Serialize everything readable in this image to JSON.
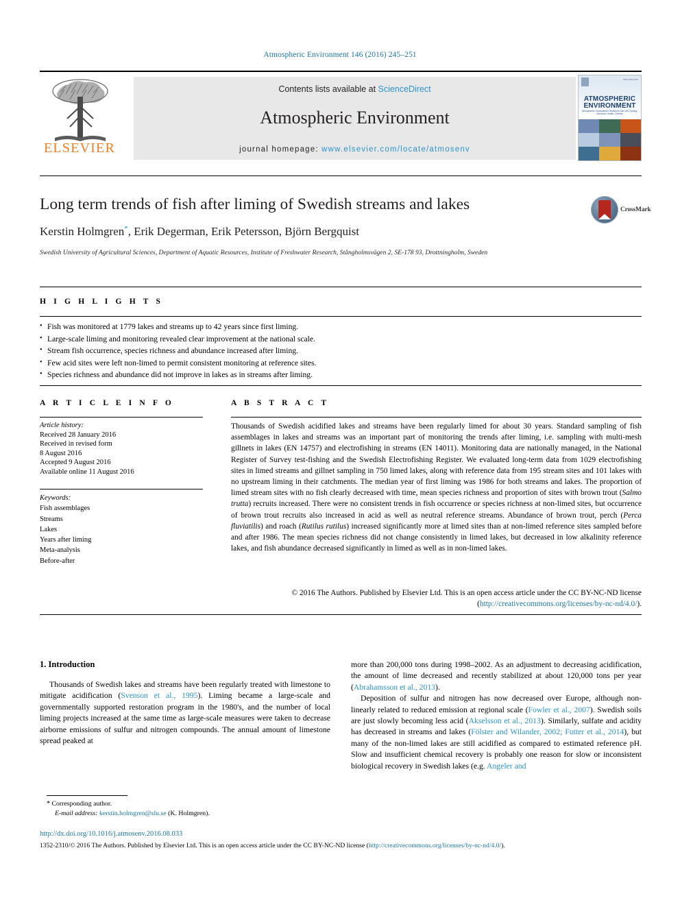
{
  "running_head": "Atmospheric Environment 146 (2016) 245–251",
  "masthead": {
    "publisher_wordmark": "ELSEVIER",
    "contents_prefix": "Contents lists available at ",
    "contents_link": "ScienceDirect",
    "journal_name": "Atmospheric Environment",
    "homepage_label": "journal homepage: ",
    "homepage_url": "www.elsevier.com/locate/atmosenv",
    "cover": {
      "title_line1": "ATMOSPHERIC",
      "title_line2": "ENVIRONMENT",
      "subtitle": "Atmospheric Composition Reactions Gas Life Cycling, Aerosols, Health, Climate",
      "issn_corner": "ISSN 1352-2310"
    }
  },
  "article": {
    "title": "Long term trends of fish after liming of Swedish streams and lakes",
    "authors": "Kerstin Holmgren, Erik Degerman, Erik Petersson, Björn Bergquist",
    "corresponding_marker": "*",
    "affiliation": "Swedish University of Agricultural Sciences, Department of Aquatic Resources, Institute of Freshwater Research, Stångholmsvägen 2, SE-178 93, Drottningholm, Sweden",
    "crossmark_label": "CrossMark"
  },
  "highlights": {
    "heading": "H I G H L I G H T S",
    "items": [
      "Fish was monitored at 1779 lakes and streams up to 42 years since first liming.",
      "Large-scale liming and monitoring revealed clear improvement at the national scale.",
      "Stream fish occurrence, species richness and abundance increased after liming.",
      "Few acid sites were left non-limed to permit consistent monitoring at reference sites.",
      "Species richness and abundance did not improve in lakes as in streams after liming."
    ]
  },
  "article_info": {
    "heading": "A R T I C L E  I N F O",
    "history_label": "Article history:",
    "history": [
      "Received 28 January 2016",
      "Received in revised form",
      "8 August 2016",
      "Accepted 9 August 2016",
      "Available online 11 August 2016"
    ],
    "keywords_label": "Keywords:",
    "keywords": [
      "Fish assemblages",
      "Streams",
      "Lakes",
      "Years after liming",
      "Meta-analysis",
      "Before-after"
    ]
  },
  "abstract": {
    "heading": "A B S T R A C T",
    "p1_a": "Thousands of Swedish acidified lakes and streams have been regularly limed for about 30 years. Standard sampling of fish assemblages in lakes and streams was an important part of monitoring the trends after liming, i.e. sampling with multi-mesh gillnets in lakes (EN 14757) and electrofishing in streams (EN 14011). Monitoring data are nationally managed, in the National Register of Survey test-fishing and the Swedish Electrofishing Register. We evaluated long-term data from 1029 electrofishing sites in limed streams and gillnet sampling in 750 limed lakes, along with reference data from 195 stream sites and 101 lakes with no upstream liming in their catchments. The median year of first liming was 1986 for both streams and lakes. The proportion of limed stream sites with no fish clearly decreased with time, mean species richness and proportion of sites with brown trout (",
    "sp1": "Salmo trutta",
    "p1_b": ") recruits increased. There were no consistent trends in fish occurrence or species richness at non-limed sites, but occurrence of brown trout recruits also increased in acid as well as neutral reference streams. Abundance of brown trout, perch (",
    "sp2": "Perca fluviatilis",
    "p1_c": ") and roach (",
    "sp3": "Rutilus rutilus",
    "p1_d": ") increased significantly more at limed sites than at non-limed reference sites sampled before and after 1986. The mean species richness did not change consistently in limed lakes, but decreased in low alkalinity reference lakes, and fish abundance decreased significantly in limed as well as in non-limed lakes.",
    "copyright_a": "© 2016 The Authors. Published by Elsevier Ltd. This is an open access article under the CC BY-NC-ND license (",
    "copyright_link": "http://creativecommons.org/licenses/by-nc-nd/4.0/",
    "copyright_b": ")."
  },
  "body": {
    "section_number_title": "1. Introduction",
    "left": {
      "p1_a": "Thousands of Swedish lakes and streams have been regularly treated with limestone to mitigate acidification (",
      "p1_ref1": "Svenson et al., 1995",
      "p1_b": "). Liming became a large-scale and governmentally supported restoration program in the 1980's, and the number of local liming projects increased at the same time as large-scale measures were taken to decrease airborne emissions of sulfur and nitrogen compounds. The annual amount of limestone spread peaked at"
    },
    "right": {
      "p1_a": "more than 200,000 tons during 1998–2002. As an adjustment to decreasing acidification, the amount of lime decreased and recently stabilized at about 120,000 tons per year (",
      "p1_ref1": "Abrahamsson et al., 2013",
      "p1_b": ").",
      "p2_a": "Deposition of sulfur and nitrogen has now decreased over Europe, although non-linearly related to reduced emission at regional scale (",
      "p2_ref1": "Fowler et al., 2007",
      "p2_b": "). Swedish soils are just slowly becoming less acid (",
      "p2_ref2": "Akselsson et al., 2013",
      "p2_c": "). Similarly, sulfate and acidity has decreased in streams and lakes (",
      "p2_ref3": "Fölster and Wilander, 2002; Futter et al., 2014",
      "p2_d": "), but many of the non-limed lakes are still acidified as compared to estimated reference pH. Slow and insufficient chemical recovery is probably one reason for slow or inconsistent biological recovery in Swedish lakes (e.g. ",
      "p2_ref4": "Angeler and"
    }
  },
  "footnote": {
    "star": "*",
    "corresponding": "Corresponding author.",
    "email_label": "E-mail address:",
    "email": "kerstin.holmgren@slu.se",
    "email_owner": "(K. Holmgren)."
  },
  "bottom": {
    "doi": "http://dx.doi.org/10.1016/j.atmosenv.2016.08.033",
    "issn_a": "1352-2310/© 2016 The Authors. Published by Elsevier Ltd. This is an open access article under the CC BY-NC-ND license (",
    "issn_link": "http://creativecommons.org/licenses/by-nc-nd/4.0/",
    "issn_b": ")."
  },
  "colors": {
    "link": "#1b78a8",
    "reference": "#2a93cd",
    "elsevier_orange": "#f47c20",
    "banner_gray": "#e8e8e8"
  }
}
